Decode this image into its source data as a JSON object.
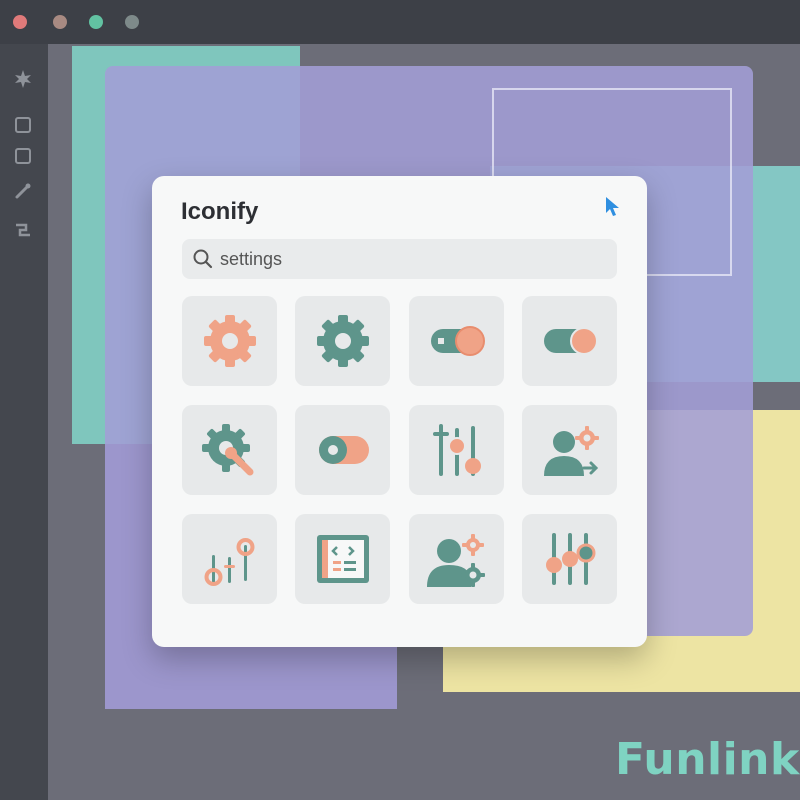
{
  "window": {
    "traffic_lights": [
      {
        "name": "close",
        "color": "#e07a7a"
      },
      {
        "name": "minimize",
        "color": "#a88a82"
      },
      {
        "name": "zoom",
        "color": "#62c2a2"
      },
      {
        "name": "extra",
        "color": "#7e8a8a"
      }
    ]
  },
  "sidebar": {
    "tools": [
      "star-tool-icon",
      "square-tool-icon",
      "frame-tool-icon",
      "pen-tool-icon",
      "link-tool-icon"
    ]
  },
  "panel": {
    "title": "Iconify",
    "search": {
      "value": "settings",
      "placeholder": ""
    },
    "icons": [
      "gear-icon",
      "gear-icon",
      "toggle-icon",
      "toggle-icon",
      "gear-wrench-icon",
      "toggle-icon",
      "sliders-icon",
      "user-settings-icon",
      "sliders-icon",
      "code-window-icon",
      "user-settings-icon",
      "sliders-icon"
    ]
  },
  "colors": {
    "accent_orange": "#f0a387",
    "accent_teal": "#5e958b",
    "cursor_blue": "#2f8fe0"
  },
  "brand": {
    "logo": "Funlink"
  }
}
